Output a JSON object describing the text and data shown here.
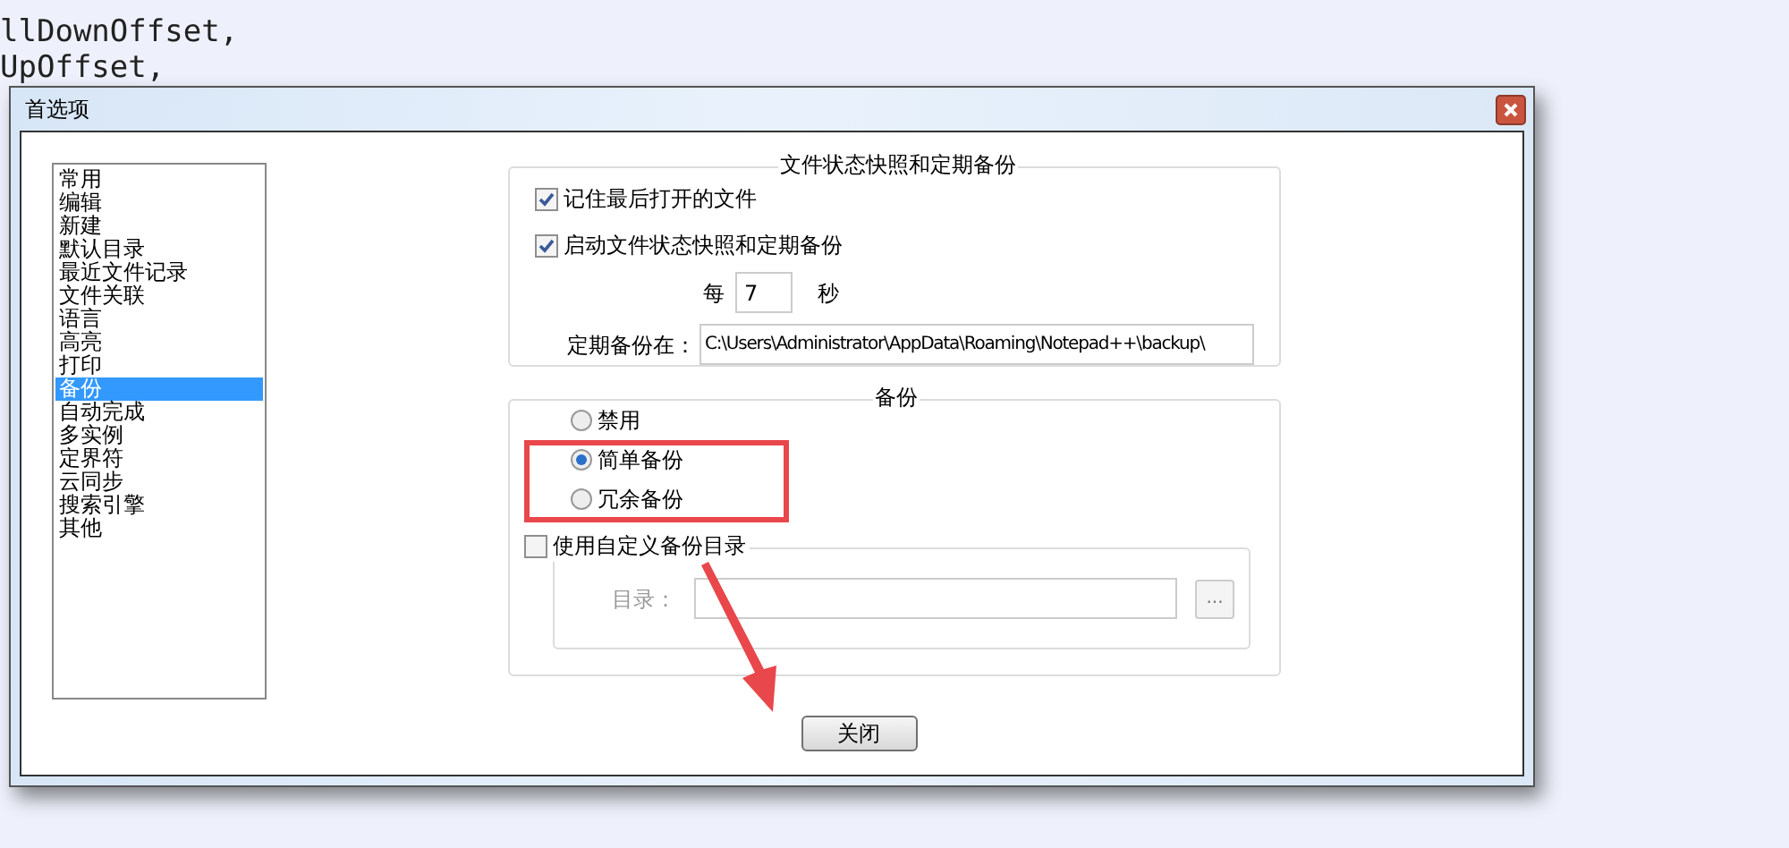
{
  "editor_lines": [
    "llDownOffset,",
    "UpOffset,"
  ],
  "dialog": {
    "title": "首选项"
  },
  "categories": [
    {
      "label": "常用",
      "selected": false
    },
    {
      "label": "编辑",
      "selected": false
    },
    {
      "label": "新建",
      "selected": false
    },
    {
      "label": "默认目录",
      "selected": false
    },
    {
      "label": "最近文件记录",
      "selected": false
    },
    {
      "label": "文件关联",
      "selected": false
    },
    {
      "label": "语言",
      "selected": false
    },
    {
      "label": "高亮",
      "selected": false
    },
    {
      "label": "打印",
      "selected": false
    },
    {
      "label": "备份",
      "selected": true
    },
    {
      "label": "自动完成",
      "selected": false
    },
    {
      "label": "多实例",
      "selected": false
    },
    {
      "label": "定界符",
      "selected": false
    },
    {
      "label": "云同步",
      "selected": false
    },
    {
      "label": "搜索引擎",
      "selected": false
    },
    {
      "label": "其他",
      "selected": false
    }
  ],
  "snapshot_group": {
    "title": "文件状态快照和定期备份",
    "options": [
      {
        "label": "记住最后打开的文件",
        "checked": true
      },
      {
        "label": "启动文件状态快照和定期备份",
        "checked": true
      }
    ],
    "interval_prefix": "每",
    "interval_value": "7",
    "interval_unit": "秒",
    "path_label": "定期备份在：",
    "path_value": "C:\\Users\\Administrator\\AppData\\Roaming\\Notepad++\\backup\\"
  },
  "backup_group": {
    "title": "备份",
    "modes": [
      {
        "label": "禁用",
        "selected": false
      },
      {
        "label": "简单备份",
        "selected": true
      },
      {
        "label": "冗余备份",
        "selected": false
      }
    ],
    "custom_dir": {
      "label": "使用自定义备份目录",
      "checked": false,
      "dir_label": "目录：",
      "browse": "..."
    }
  },
  "close_button": "关闭"
}
